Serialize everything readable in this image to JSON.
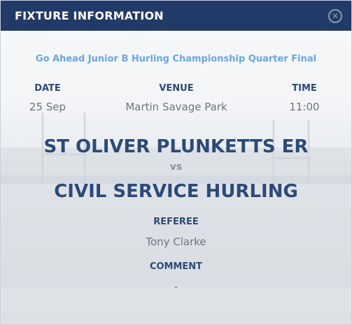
{
  "header": {
    "title": "FIXTURE INFORMATION",
    "close_icon": "close-circle-icon"
  },
  "fixture": {
    "competition": "Go Ahead Junior B Hurling Championship Quarter Final",
    "date_label": "DATE",
    "date_value": "25 Sep",
    "venue_label": "VENUE",
    "venue_value": "Martin Savage Park",
    "time_label": "TIME",
    "time_value": "11:00",
    "home_team": "ST OLIVER PLUNKETTS ER",
    "vs": "vs",
    "away_team": "CIVIL SERVICE HURLING",
    "referee_label": "REFEREE",
    "referee_value": "Tony Clarke",
    "comment_label": "COMMENT",
    "comment_value": "-"
  },
  "colors": {
    "header_bg": "#213a67",
    "accent_link": "#6aa6e3",
    "heading_text": "#2c4a78",
    "body_text": "#6e7580"
  }
}
